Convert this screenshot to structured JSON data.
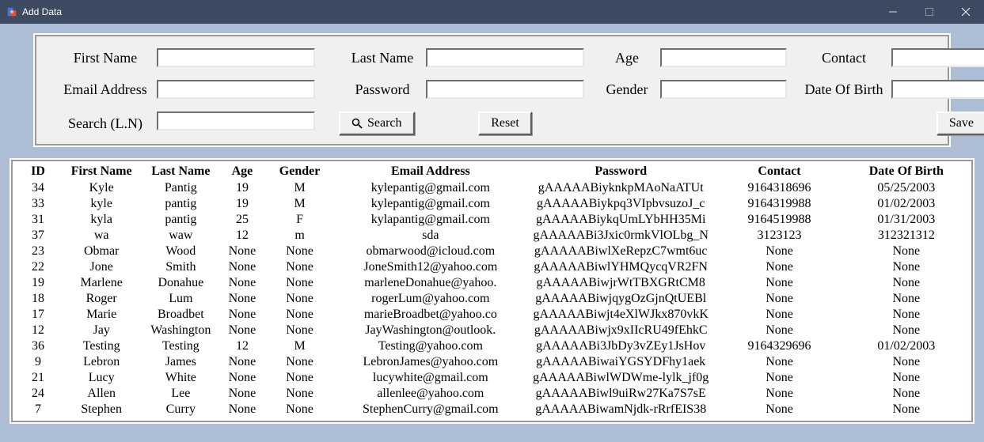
{
  "window": {
    "title": "Add Data"
  },
  "form": {
    "labels": {
      "first_name": "First Name",
      "last_name": "Last Name",
      "age": "Age",
      "contact": "Contact",
      "email": "Email Address",
      "password": "Password",
      "gender": "Gender",
      "dob": "Date Of Birth",
      "search": "Search (L.N)"
    },
    "values": {
      "first_name": "",
      "last_name": "",
      "age": "",
      "contact": "",
      "email": "",
      "password": "",
      "gender": "",
      "dob": "",
      "search": ""
    },
    "buttons": {
      "search": "Search",
      "reset": "Reset",
      "save": "Save"
    }
  },
  "table": {
    "columns": [
      "ID",
      "First Name",
      "Last Name",
      "Age",
      "Gender",
      "Email Address",
      "Password",
      "Contact",
      "Date Of Birth"
    ],
    "rows": [
      {
        "id": "34",
        "fn": "Kyle",
        "ln": "Pantig",
        "age": "19",
        "gen": "M",
        "em": "kylepantig@gmail.com",
        "pw": "gAAAAABiyknkpMAoNaATUt",
        "ct": "9164318696",
        "dob": "05/25/2003"
      },
      {
        "id": "33",
        "fn": "kyle",
        "ln": "pantig",
        "age": "19",
        "gen": "M",
        "em": "kylepantig@gmail.com",
        "pw": "gAAAAABiykpq3VIpbvsuzoJ_c",
        "ct": "9164319988",
        "dob": "01/02/2003"
      },
      {
        "id": "31",
        "fn": "kyla",
        "ln": "pantig",
        "age": "25",
        "gen": "F",
        "em": "kylapantig@gmail.com",
        "pw": "gAAAAABiykqUmLYbHH35Mi",
        "ct": "9164519988",
        "dob": "01/31/2003"
      },
      {
        "id": "37",
        "fn": "wa",
        "ln": "waw",
        "age": "12",
        "gen": "m",
        "em": "sda",
        "pw": "gAAAAABi3Jxic0rmkVlOLbg_N",
        "ct": "3123123",
        "dob": "312321312"
      },
      {
        "id": "23",
        "fn": "Obmar",
        "ln": "Wood",
        "age": "None",
        "gen": "None",
        "em": "obmarwood@icloud.com",
        "pw": "gAAAAABiwlXeRepzC7wmt6uc",
        "ct": "None",
        "dob": "None"
      },
      {
        "id": "22",
        "fn": "Jone",
        "ln": "Smith",
        "age": "None",
        "gen": "None",
        "em": "JoneSmith12@yahoo.com",
        "pw": "gAAAAABiwlYHMQycqVR2FN",
        "ct": "None",
        "dob": "None"
      },
      {
        "id": "19",
        "fn": "Marlene",
        "ln": "Donahue",
        "age": "None",
        "gen": "None",
        "em": "marleneDonahue@yahoo.",
        "pw": "gAAAAABiwjrWtTBXGRtCM8",
        "ct": "None",
        "dob": "None"
      },
      {
        "id": "18",
        "fn": "Roger",
        "ln": "Lum",
        "age": "None",
        "gen": "None",
        "em": "rogerLum@yahoo.com",
        "pw": "gAAAAABiwjqygOzGjnQtUEBl",
        "ct": "None",
        "dob": "None"
      },
      {
        "id": "17",
        "fn": "Marie",
        "ln": "Broadbet",
        "age": "None",
        "gen": "None",
        "em": "marieBroadbet@yahoo.co",
        "pw": "gAAAAABiwjt4eXlWJkx870vkK",
        "ct": "None",
        "dob": "None"
      },
      {
        "id": "12",
        "fn": "Jay",
        "ln": "Washington",
        "age": "None",
        "gen": "None",
        "em": "JayWashington@outlook.",
        "pw": "gAAAAABiwjx9xIIcRU49fEhkC",
        "ct": "None",
        "dob": "None"
      },
      {
        "id": "36",
        "fn": "Testing",
        "ln": "Testing",
        "age": "12",
        "gen": "M",
        "em": "Testing@yahoo.com",
        "pw": "gAAAAABi3JbDy3vZEy1JsHov",
        "ct": "9164329696",
        "dob": "01/02/2003"
      },
      {
        "id": "9",
        "fn": "Lebron",
        "ln": "James",
        "age": "None",
        "gen": "None",
        "em": "LebronJames@yahoo.com",
        "pw": "gAAAAABiwaiYGSYDFhy1aek",
        "ct": "None",
        "dob": "None"
      },
      {
        "id": "21",
        "fn": "Lucy",
        "ln": "White",
        "age": "None",
        "gen": "None",
        "em": "lucywhite@gmail.com",
        "pw": "gAAAAABiwlWDWme-lylk_jf0g",
        "ct": "None",
        "dob": "None"
      },
      {
        "id": "24",
        "fn": "Allen",
        "ln": "Lee",
        "age": "None",
        "gen": "None",
        "em": "allenlee@yahoo.com",
        "pw": "gAAAAABiwl9uiRw27Ka7S7sE",
        "ct": "None",
        "dob": "None"
      },
      {
        "id": "7",
        "fn": "Stephen",
        "ln": "Curry",
        "age": "None",
        "gen": "None",
        "em": "StephenCurry@gmail.com",
        "pw": "gAAAAABiwamNjdk-rRrfEIS38",
        "ct": "None",
        "dob": "None"
      }
    ]
  }
}
